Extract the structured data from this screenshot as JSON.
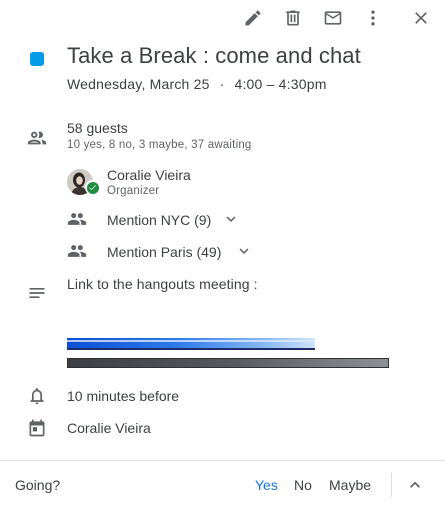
{
  "toolbar": {
    "actions": [
      {
        "name": "edit",
        "icon": "pencil-icon"
      },
      {
        "name": "delete",
        "icon": "trash-icon"
      },
      {
        "name": "email",
        "icon": "mail-icon"
      },
      {
        "name": "more",
        "icon": "more-vert-icon"
      },
      {
        "name": "close",
        "icon": "close-icon"
      }
    ]
  },
  "event": {
    "color": "#039be5",
    "title": "Take a Break : come and chat",
    "date": "Wednesday, March 25",
    "separator": "·",
    "time": "4:00 – 4:30pm"
  },
  "guests": {
    "count_label": "58 guests",
    "summary": "10 yes, 8 no, 3 maybe, 37 awaiting",
    "organizer": {
      "name": "Coralie Vieira",
      "role": "Organizer",
      "status_color": "#1e8e3e"
    },
    "groups": [
      {
        "label": "Mention NYC (9)"
      },
      {
        "label": "Mention Paris (49)"
      }
    ]
  },
  "description": {
    "text": "Link to the hangouts meeting :"
  },
  "notification": {
    "label": "10 minutes before"
  },
  "calendar": {
    "name": "Coralie Vieira"
  },
  "rsvp": {
    "prompt": "Going?",
    "yes": "Yes",
    "no": "No",
    "maybe": "Maybe",
    "accent": "#1a73e8"
  }
}
